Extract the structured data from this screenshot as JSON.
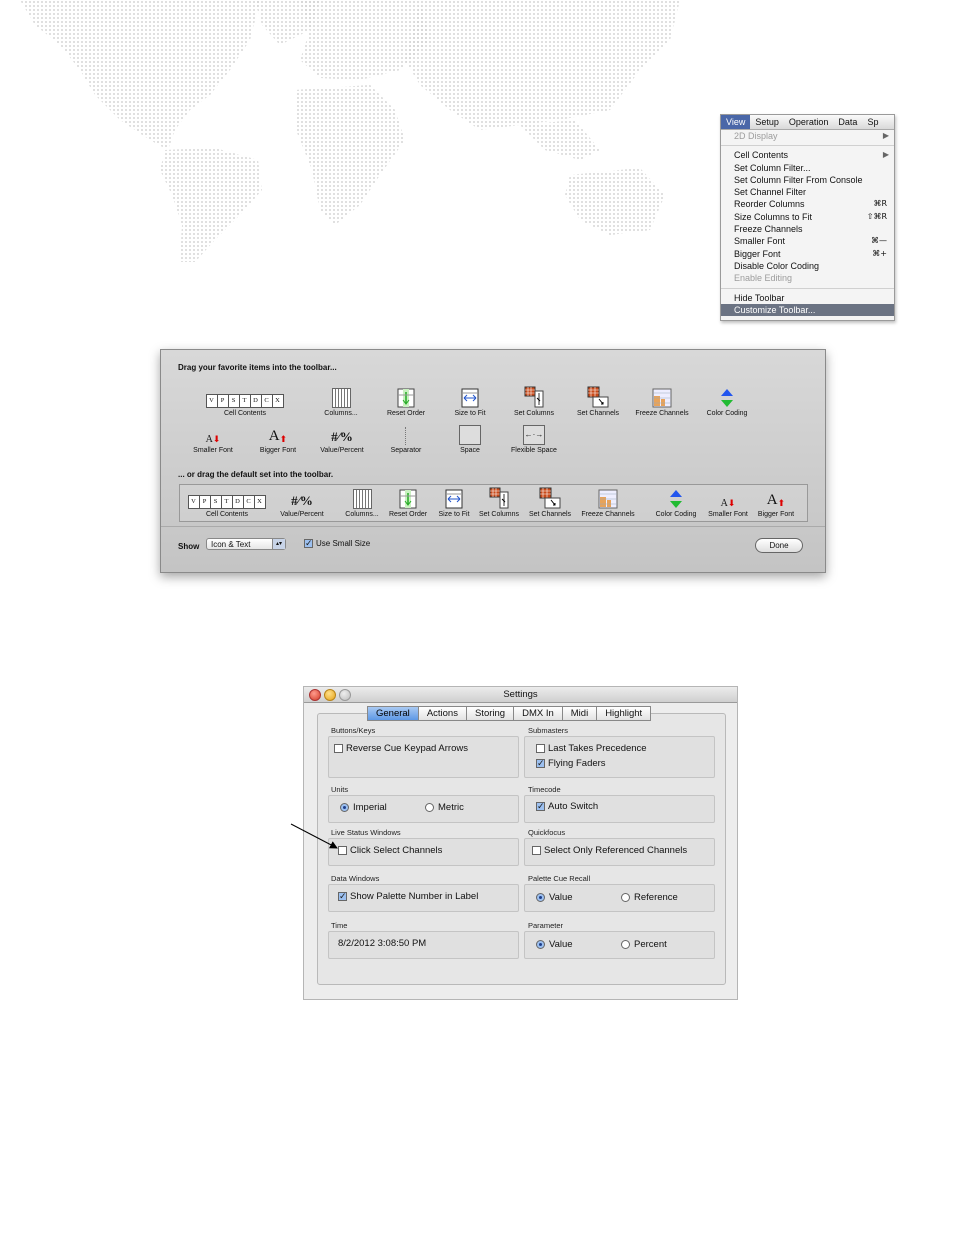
{
  "menu": {
    "bar": [
      "View",
      "Setup",
      "Operation",
      "Data",
      "Sp"
    ],
    "items": [
      {
        "label": "2D Display",
        "disabled": true,
        "submenu": true
      },
      {
        "separator": true
      },
      {
        "label": "Cell Contents",
        "submenu": true
      },
      {
        "label": "Set Column Filter..."
      },
      {
        "label": "Set Column Filter From Console"
      },
      {
        "label": "Set Channel Filter"
      },
      {
        "label": "Reorder Columns",
        "shortcut": "⌘R"
      },
      {
        "label": "Size Columns to Fit",
        "shortcut": "⇧⌘R"
      },
      {
        "label": "Freeze Channels"
      },
      {
        "label": "Smaller Font",
        "shortcut": "⌘—"
      },
      {
        "label": "Bigger Font",
        "shortcut": "⌘+"
      },
      {
        "label": "Disable Color Coding"
      },
      {
        "label": "Enable Editing",
        "disabled": true
      },
      {
        "separator": true
      },
      {
        "label": "Hide Toolbar"
      },
      {
        "label": "Customize Toolbar...",
        "selected": true
      }
    ]
  },
  "toolbar_sheet": {
    "heading_favorites": "Drag your favorite items into the toolbar...",
    "heading_default": "... or drag the default set into the toolbar.",
    "cell_letters": [
      "V",
      "P",
      "S",
      "T",
      "D",
      "C",
      "X"
    ],
    "value_percent_glyph": "#⁄%",
    "flex_glyph": "←·→",
    "font_glyph": "A",
    "favorites": [
      {
        "id": "cell-contents",
        "label": "Cell Contents"
      },
      {
        "id": "columns",
        "label": "Columns..."
      },
      {
        "id": "reset-order",
        "label": "Reset Order"
      },
      {
        "id": "size-to-fit",
        "label": "Size to Fit"
      },
      {
        "id": "set-columns",
        "label": "Set Columns"
      },
      {
        "id": "set-channels",
        "label": "Set Channels"
      },
      {
        "id": "freeze-channels",
        "label": "Freeze Channels"
      },
      {
        "id": "color-coding",
        "label": "Color Coding"
      },
      {
        "id": "smaller-font",
        "label": "Smaller Font"
      },
      {
        "id": "bigger-font",
        "label": "Bigger Font"
      },
      {
        "id": "value-percent",
        "label": "Value/Percent"
      },
      {
        "id": "separator",
        "label": "Separator"
      },
      {
        "id": "space",
        "label": "Space"
      },
      {
        "id": "flexible-space",
        "label": "Flexible Space"
      }
    ],
    "default_set": [
      {
        "id": "cell-contents",
        "label": "Cell Contents"
      },
      {
        "id": "value-percent",
        "label": "Value/Percent"
      },
      {
        "id": "columns",
        "label": "Columns..."
      },
      {
        "id": "reset-order",
        "label": "Reset Order"
      },
      {
        "id": "size-to-fit",
        "label": "Size to Fit"
      },
      {
        "id": "set-columns",
        "label": "Set Columns"
      },
      {
        "id": "set-channels",
        "label": "Set Channels"
      },
      {
        "id": "freeze-channels",
        "label": "Freeze Channels"
      },
      {
        "id": "color-coding",
        "label": "Color Coding"
      },
      {
        "id": "smaller-font",
        "label": "Smaller Font"
      },
      {
        "id": "bigger-font",
        "label": "Bigger Font"
      }
    ],
    "show_label": "Show",
    "show_value": "Icon & Text",
    "small_size_label": "Use Small Size",
    "small_size_checked": true,
    "done_label": "Done"
  },
  "settings": {
    "title": "Settings",
    "tabs": [
      "General",
      "Actions",
      "Storing",
      "DMX In",
      "Midi",
      "Highlight"
    ],
    "active_tab": "General",
    "groups": {
      "buttons_keys": {
        "title": "Buttons/Keys",
        "options": [
          {
            "label": "Reverse Cue Keypad Arrows",
            "checked": false
          }
        ]
      },
      "submasters": {
        "title": "Submasters",
        "options": [
          {
            "label": "Last Takes Precedence",
            "checked": false
          },
          {
            "label": "Flying Faders",
            "checked": true
          }
        ]
      },
      "units": {
        "title": "Units",
        "options": [
          {
            "label": "Imperial",
            "selected": true
          },
          {
            "label": "Metric",
            "selected": false
          }
        ]
      },
      "timecode": {
        "title": "Timecode",
        "options": [
          {
            "label": "Auto Switch",
            "checked": true
          }
        ]
      },
      "live_status": {
        "title": "Live Status Windows",
        "options": [
          {
            "label": "Click Select Channels",
            "checked": false
          }
        ]
      },
      "quickfocus": {
        "title": "Quickfocus",
        "options": [
          {
            "label": "Select Only Referenced Channels",
            "checked": false
          }
        ]
      },
      "data_windows": {
        "title": "Data Windows",
        "options": [
          {
            "label": "Show Palette Number in Label",
            "checked": true
          }
        ]
      },
      "palette_cue_recall": {
        "title": "Palette Cue Recall",
        "options": [
          {
            "label": "Value",
            "selected": true
          },
          {
            "label": "Reference",
            "selected": false
          }
        ]
      },
      "time": {
        "title": "Time",
        "value": "8/2/2012 3:08:50 PM"
      },
      "parameter": {
        "title": "Parameter",
        "options": [
          {
            "label": "Value",
            "selected": true
          },
          {
            "label": "Percent",
            "selected": false
          }
        ]
      }
    },
    "check_glyph": "✓"
  }
}
